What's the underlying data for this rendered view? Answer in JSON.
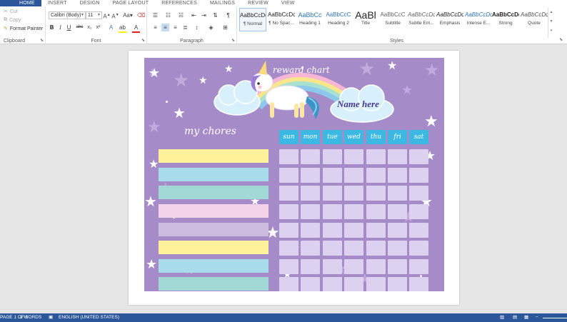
{
  "tabs": [
    "HOME",
    "INSERT",
    "DESIGN",
    "PAGE LAYOUT",
    "REFERENCES",
    "MAILINGS",
    "REVIEW",
    "VIEW"
  ],
  "clipboard": {
    "cut": "Cut",
    "copy": "Copy",
    "format_painter": "Format Painter",
    "label": "Clipboard"
  },
  "font": {
    "name": "Calibri (Body)",
    "size": "11",
    "label": "Font"
  },
  "paragraph": {
    "label": "Paragraph"
  },
  "styles": {
    "label": "Styles",
    "items": [
      {
        "sample": "AaBbCcDc",
        "name": "¶ Normal"
      },
      {
        "sample": "AaBbCcDc",
        "name": "¶ No Spac..."
      },
      {
        "sample": "AaBbCc",
        "name": "Heading 1"
      },
      {
        "sample": "AaBbCcC",
        "name": "Heading 2"
      },
      {
        "sample": "AaBl",
        "name": "Title"
      },
      {
        "sample": "AaBbCcC",
        "name": "Subtitle"
      },
      {
        "sample": "AaBbCcDc",
        "name": "Subtle Em..."
      },
      {
        "sample": "AaBbCcDc",
        "name": "Emphasis"
      },
      {
        "sample": "AaBbCcDc",
        "name": "Intense E..."
      },
      {
        "sample": "AaBbCcDc",
        "name": "Strong"
      },
      {
        "sample": "AaBbCcDc",
        "name": "Quote"
      }
    ]
  },
  "chart": {
    "title": "reward chart",
    "name_placeholder": "Name here",
    "chores_heading": "my chores",
    "days": [
      "sun",
      "mon",
      "tue",
      "wed",
      "thu",
      "fri",
      "sat"
    ],
    "bar_colors": [
      "#fdf29a",
      "#a9dceb",
      "#a2d9d6",
      "#f2d3ea",
      "#cdbce0",
      "#fdf29a",
      "#a9dceb",
      "#a2d9d6"
    ],
    "background": "#a58bc8",
    "header_color": "#3cb9e2"
  },
  "status": {
    "page": "PAGE 1 OF 1",
    "words": "2 WORDS",
    "language": "ENGLISH (UNITED STATES)"
  }
}
